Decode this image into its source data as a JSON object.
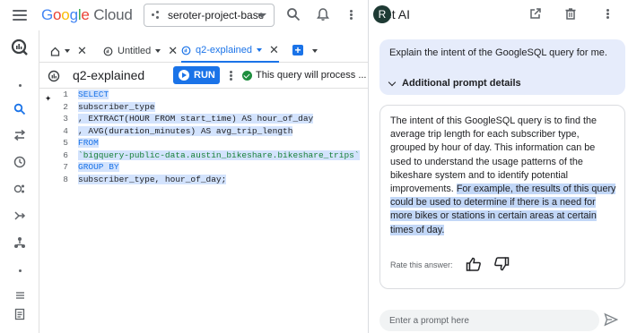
{
  "app": {
    "logo_google": "Google",
    "logo_cloud": "Cloud",
    "project": "seroter-project-base"
  },
  "tabs": [
    {
      "label": "Untitled"
    },
    {
      "label": "q2-explained"
    }
  ],
  "query": {
    "title": "q2-explained",
    "run_label": "RUN",
    "status": "This query will process ..."
  },
  "code_lines": [
    {
      "num": "1",
      "text": "SELECT"
    },
    {
      "num": "2",
      "text": "subscriber_type"
    },
    {
      "num": "3",
      "text": ", EXTRACT(HOUR FROM start_time) AS hour_of_day"
    },
    {
      "num": "4",
      "text": ", AVG(duration_minutes) AS avg_trip_length"
    },
    {
      "num": "5",
      "text": "FROM"
    },
    {
      "num": "6",
      "text": "`bigquery-public-data.austin_bikeshare.bikeshare_trips`"
    },
    {
      "num": "7",
      "text": "GROUP BY"
    },
    {
      "num": "8",
      "text": "subscriber_type, hour_of_day;"
    }
  ],
  "gemini": {
    "avatar_letter": "R",
    "title": "et AI",
    "user_prompt": "Explain the intent of the GoogleSQL query for me.",
    "details_label": "Additional prompt details",
    "answer_plain": "The intent of this GoogleSQL query is to find the average trip length for each subscriber type, grouped by hour of day. This information can be used to understand the usage patterns of the bikeshare system and to identify potential improvements. ",
    "answer_selected": "For example, the results of this query could be used to determine if there is a need for more bikes or stations in certain areas at certain times of day.",
    "rate_label": "Rate this answer:",
    "prompt_placeholder": "Enter a prompt here"
  },
  "colors": {
    "accent": "#1a73e8",
    "selection": "#d3e3fd",
    "user_bubble": "#e6ecfb",
    "success": "#1e8e3e"
  }
}
